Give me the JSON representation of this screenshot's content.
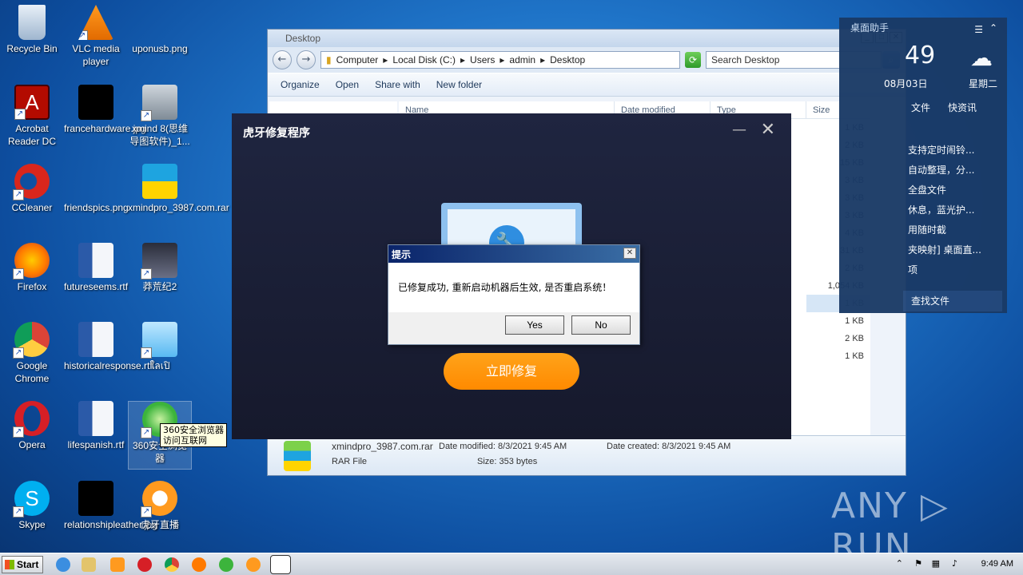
{
  "desktop": {
    "icons": [
      {
        "label": "Recycle Bin"
      },
      {
        "label": "VLC media player"
      },
      {
        "label": "uponusb.png"
      },
      {
        "label": "Acrobat Reader DC"
      },
      {
        "label": "francehardware.jpg"
      },
      {
        "label": "xmind 8(思维导图软件)_1..."
      },
      {
        "label": "CCleaner"
      },
      {
        "label": "friendspics.png"
      },
      {
        "label": "xmindpro_3987.com.rar"
      },
      {
        "label": "Firefox"
      },
      {
        "label": "futureseems.rtf"
      },
      {
        "label": "莽荒纪2"
      },
      {
        "label": "Google Chrome"
      },
      {
        "label": "historicalresponse.rtf"
      },
      {
        "label": "ใลเปิ"
      },
      {
        "label": "Opera"
      },
      {
        "label": "lifespanish.rtf"
      },
      {
        "label": "360安全浏览器"
      },
      {
        "label": "Skype"
      },
      {
        "label": "relationshipleather.jpg"
      },
      {
        "label": "虎牙直播"
      }
    ],
    "tooltip": "360安全浏览器 访问互联网",
    "watermark": "ANY ▷ RUN"
  },
  "explorer": {
    "title": "Desktop",
    "breadcrumb": [
      "Computer",
      "Local Disk (C:)",
      "Users",
      "admin",
      "Desktop"
    ],
    "search_placeholder": "Search Desktop",
    "toolbar": [
      "Organize",
      "Open",
      "Share with",
      "New folder"
    ],
    "columns": [
      "Name",
      "Date modified",
      "Type",
      "Size"
    ],
    "sizes": [
      "1 KB",
      "2 KB",
      "15 KB",
      "3 KB",
      "3 KB",
      "3 KB",
      "4 KB",
      "31 KB",
      "2 KB",
      "1,054 KB",
      "1 KB",
      "1 KB",
      "2 KB",
      "1 KB"
    ],
    "selected_index": 10,
    "details": {
      "filename": "xmindpro_3987.com.rar",
      "modified": "Date modified: 8/3/2021 9:45 AM",
      "created": "Date created: 8/3/2021 9:45 AM",
      "type": "RAR File",
      "size": "Size: 353 bytes"
    }
  },
  "widget": {
    "time": "49",
    "date": "08月03日",
    "weekday": "星期二",
    "title": "桌面助手",
    "tabs": [
      "文件",
      "快资讯"
    ],
    "items": [
      "支持定时闹铃...",
      "自动整理，分...",
      "全盘文件",
      "休息，蓝光护...",
      "用随时截",
      "夹映射] 桌面直...",
      "项"
    ],
    "find": "查找文件"
  },
  "app": {
    "title": "虎牙修复程序",
    "fix_button": "立即修复"
  },
  "dialog": {
    "title": "提示",
    "message": "已修复成功, 重新启动机器后生效, 是否重启系统！",
    "yes": "Yes",
    "no": "No"
  },
  "taskbar": {
    "start": "Start",
    "clock": "9:49 AM"
  }
}
